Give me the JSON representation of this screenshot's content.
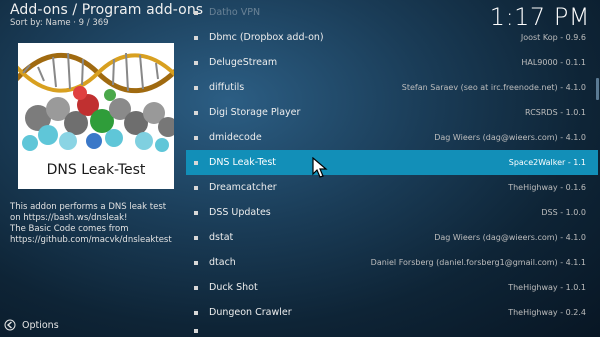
{
  "header": {
    "title": "Add-ons / Program add-ons",
    "sort": "Sort by: Name  ·  9 / 369",
    "clock": "1:17 PM"
  },
  "addon_info": {
    "thumbnail_caption": "DNS Leak-Test",
    "description_lines": [
      "This addon performs a DNS leak test",
      "on https://bash.ws/dnsleak!",
      "  The Basic Code comes from",
      "https://github.com/macvk/dnsleaktest"
    ]
  },
  "footer": {
    "options_label": "Options"
  },
  "list": {
    "items": [
      {
        "name": "Datho VPN",
        "meta": "",
        "state": "faded"
      },
      {
        "name": "Dbmc (Dropbox add-on)",
        "meta": "Joost Kop - 0.9.6",
        "state": ""
      },
      {
        "name": "DelugeStream",
        "meta": "HAL9000 - 0.1.1",
        "state": ""
      },
      {
        "name": "diffutils",
        "meta": "Stefan Saraev (seo at irc.freenode.net) - 4.1.0",
        "state": ""
      },
      {
        "name": "Digi Storage Player",
        "meta": "RCSRDS - 1.0.1",
        "state": ""
      },
      {
        "name": "dmidecode",
        "meta": "Dag Wieers (dag@wieers.com) - 4.1.0",
        "state": ""
      },
      {
        "name": "DNS Leak-Test",
        "meta": "Space2Walker - 1.1",
        "state": "selected"
      },
      {
        "name": "Dreamcatcher",
        "meta": "TheHighway - 0.1.6",
        "state": ""
      },
      {
        "name": "DSS Updates",
        "meta": "DSS - 1.0.0",
        "state": ""
      },
      {
        "name": "dstat",
        "meta": "Dag Wieers (dag@wieers.com) - 4.1.0",
        "state": ""
      },
      {
        "name": "dtach",
        "meta": "Daniel Forsberg (daniel.forsberg1@gmail.com) - 4.1.1",
        "state": ""
      },
      {
        "name": "Duck Shot",
        "meta": "TheHighway - 1.0.1",
        "state": ""
      },
      {
        "name": "Dungeon Crawler",
        "meta": "TheHighway - 0.2.4",
        "state": ""
      }
    ]
  },
  "colors": {
    "selection": "#128fb8",
    "background": "#1a3c57"
  },
  "icons": {
    "options": "options-arrow-icon",
    "cursor": "mouse-pointer-icon",
    "bullet": "bullet-square-icon"
  }
}
